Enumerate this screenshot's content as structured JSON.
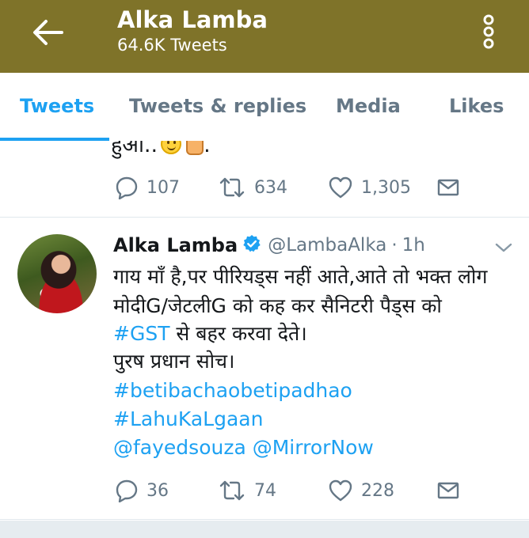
{
  "header": {
    "title": "Alka Lamba",
    "subtitle": "64.6K Tweets",
    "back_icon": "arrow-left-icon",
    "menu_icon": "more-vertical-icon",
    "bar_color": "#7f7329"
  },
  "tabs": [
    {
      "label": "Tweets",
      "active": true
    },
    {
      "label": "Tweets & replies",
      "active": false
    },
    {
      "label": "Media",
      "active": false
    },
    {
      "label": "Likes",
      "active": false
    }
  ],
  "accent_color": "#1da1f2",
  "previous_tweet": {
    "text_tail": "हुआ..",
    "text_end": ".",
    "emojis": [
      "smiling-face-icon",
      "thumbs-up-icon"
    ],
    "replies": "107",
    "retweets": "634",
    "likes": "1,305"
  },
  "tweet": {
    "author_name": "Alka Lamba",
    "verified": true,
    "handle": "@LambaAlka",
    "separator": "·",
    "time": "1h",
    "lines": {
      "l1": "गाय माँ है,पर पीरियड्स नहीं आते,आते तो भक्त लोग",
      "l2": "मोदीG/जेटलीG को कह कर सैनिटरी पैड्स को",
      "l3_link": "#GST",
      "l3_rest": " से बहर करवा देते।",
      "l4": "पुरष प्रधान सोच।",
      "l5": "#betibachaobetipadhao",
      "l6": "#LahuKaLgaan",
      "l7a": "@fayedsouza",
      "l7b": "@MirrorNow"
    },
    "replies": "36",
    "retweets": "74",
    "likes": "228"
  }
}
